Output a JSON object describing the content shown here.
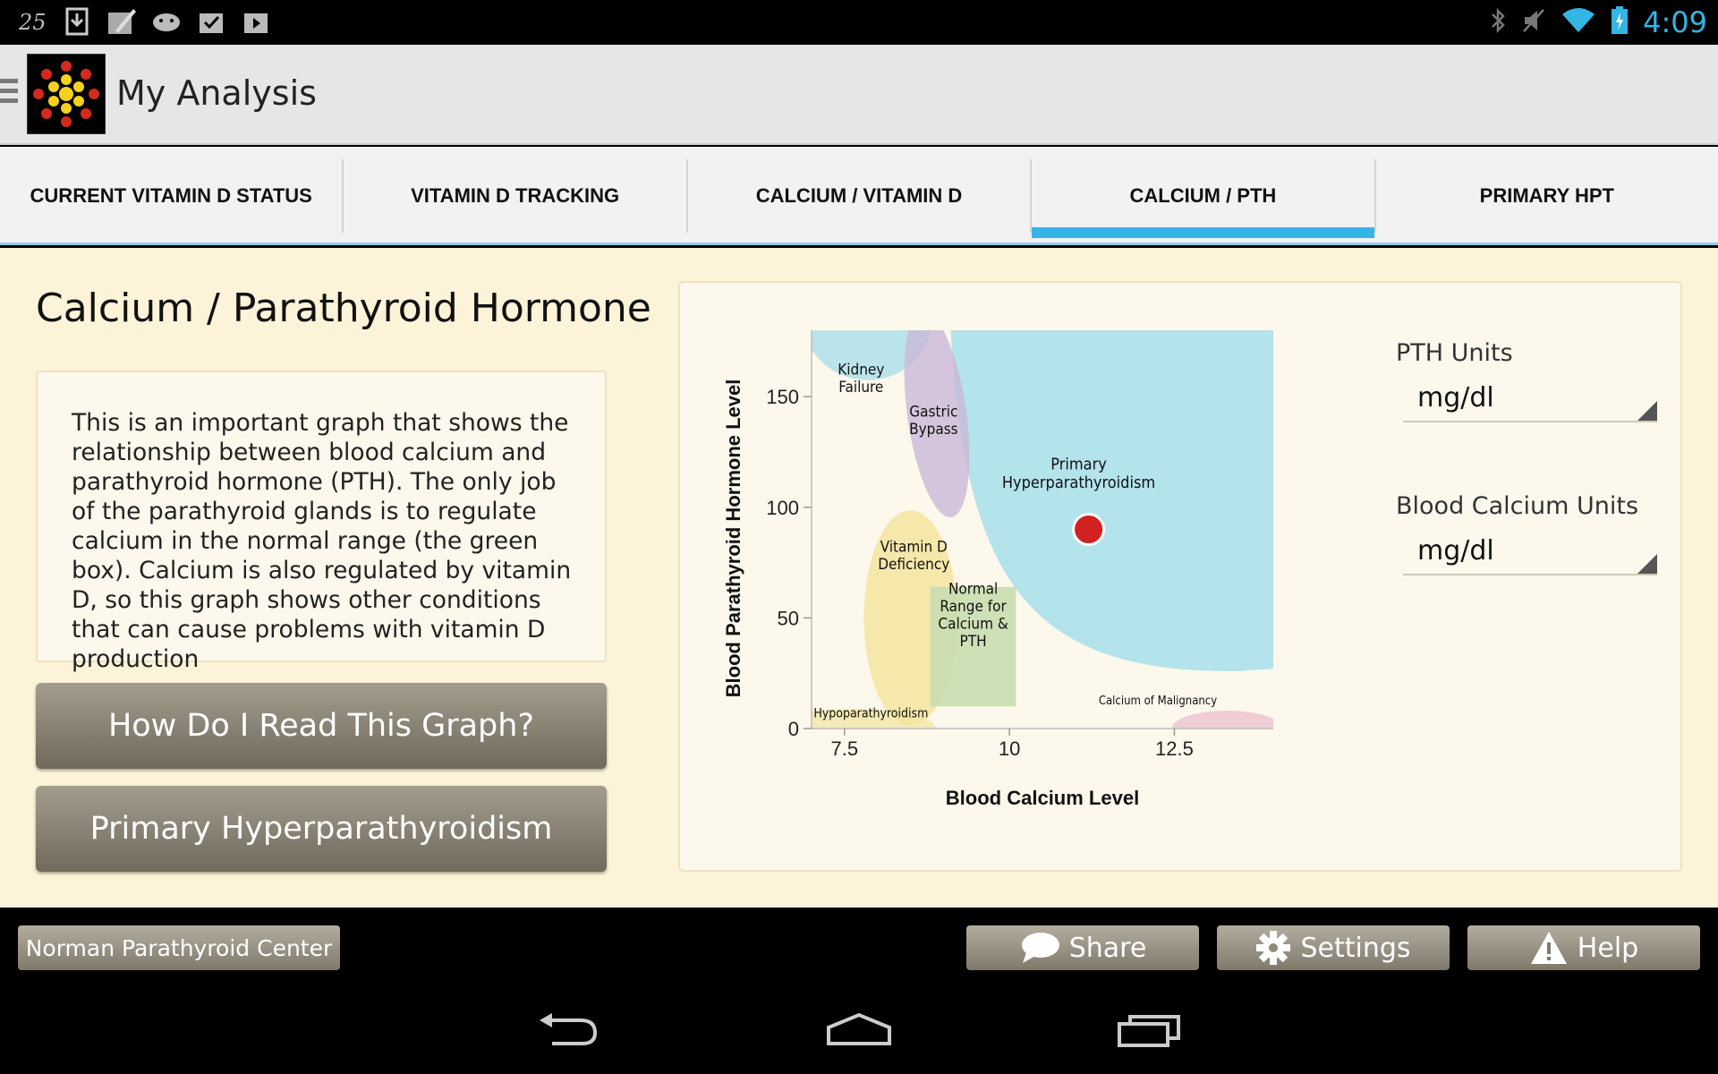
{
  "status_bar": {
    "time": "4:09",
    "left_icons": [
      "notification-25-icon",
      "download-icon",
      "image-edit-icon",
      "android-icon",
      "check-icon",
      "play-store-icon"
    ],
    "right_icons": [
      "bluetooth-icon",
      "mute-icon",
      "wifi-icon",
      "battery-charging-icon"
    ]
  },
  "action_bar": {
    "title": "My Analysis"
  },
  "tabs": [
    {
      "label": "CURRENT VITAMIN D STATUS",
      "active": false
    },
    {
      "label": "VITAMIN D TRACKING",
      "active": false
    },
    {
      "label": "CALCIUM / VITAMIN D",
      "active": false
    },
    {
      "label": "CALCIUM / PTH",
      "active": true
    },
    {
      "label": "PRIMARY HPT",
      "active": false
    }
  ],
  "main": {
    "title": "Calcium / Parathyroid Hormone",
    "description": "This is an important graph that shows the relationship between blood calcium and parathyroid hormone (PTH). The only job of the parathyroid glands is to regulate calcium in the normal range (the green box). Calcium is also regulated by vitamin D, so this graph shows other conditions that can cause problems with vitamin D production",
    "buttons": {
      "read_graph": "How Do I Read This Graph?",
      "primary_hpt": "Primary Hyperparathyroidism"
    }
  },
  "chart_data": {
    "type": "scatter",
    "xlabel": "Blood Calcium Level",
    "ylabel": "Blood Parathyroid Hormone Level",
    "xlim": [
      7,
      14
    ],
    "ylim": [
      0,
      180
    ],
    "xticks": [
      "7.5",
      "10",
      "12.5"
    ],
    "yticks": [
      "0",
      "50",
      "100",
      "150"
    ],
    "regions": [
      {
        "name": "Kidney Failure",
        "label_lines": [
          "Kidney",
          "Failure"
        ],
        "color": "#b7e2ea"
      },
      {
        "name": "Gastric Bypass",
        "label_lines": [
          "Gastric",
          "Bypass"
        ],
        "color": "#c9b8d8"
      },
      {
        "name": "Primary Hyperparathyroidism",
        "label_lines": [
          "Primary",
          "Hyperparathyroidism"
        ],
        "color": "#b3e3eb"
      },
      {
        "name": "Vitamin D Deficiency",
        "label_lines": [
          "Vitamin D",
          "Deficiency"
        ],
        "color": "#f5e4a3"
      },
      {
        "name": "Normal Range for Calcium & PTH",
        "label_lines": [
          "Normal",
          "Range for",
          "Calcium &",
          "PTH"
        ],
        "color": "#c9ddb0"
      },
      {
        "name": "Hypoparathyroidism",
        "label_lines": [
          "Hypoparathyroidism"
        ],
        "color": "#f5e8b0"
      },
      {
        "name": "Calcium of Malignancy",
        "label_lines": [
          "Calcium of Malignancy"
        ],
        "color": "#f0cdd4"
      }
    ],
    "points": [
      {
        "x": 11.2,
        "y": 90,
        "color": "#d32020"
      }
    ]
  },
  "settings": {
    "pth_units_label": "PTH Units",
    "pth_units_value": "mg/dl",
    "calcium_units_label": "Blood Calcium Units",
    "calcium_units_value": "mg/dl"
  },
  "footer": {
    "center_button": "Norman Parathyroid Center",
    "share": "Share",
    "settings": "Settings",
    "help": "Help"
  },
  "nav_icons": [
    "back-icon",
    "home-icon",
    "recent-apps-icon"
  ]
}
